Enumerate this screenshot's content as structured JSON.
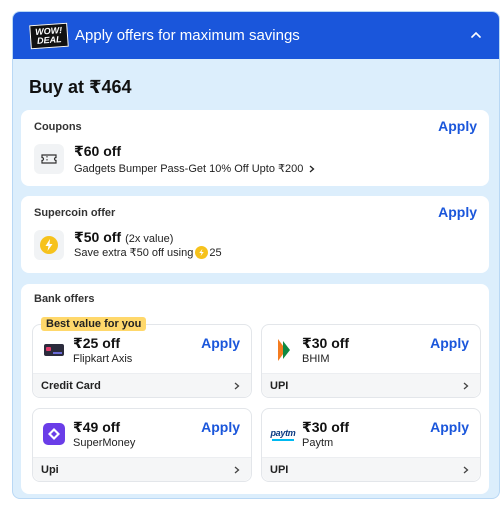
{
  "header": {
    "badge_line1": "WOW!",
    "badge_line2": "DEAL",
    "title": "Apply offers for maximum savings"
  },
  "buy_at": "Buy at ₹464",
  "coupons": {
    "title": "Coupons",
    "apply_label": "Apply",
    "amount": "₹60 off",
    "description": "Gadgets Bumper Pass-Get 10% Off Upto ₹200"
  },
  "supercoin": {
    "title": "Supercoin offer",
    "apply_label": "Apply",
    "amount": "₹50 off",
    "amount_note": "(2x value)",
    "description_prefix": "Save extra ₹50 off using",
    "coin_count": "25"
  },
  "bank": {
    "title": "Bank offers",
    "offers": [
      {
        "badge": "Best value for you",
        "amount": "₹25 off",
        "name": "Flipkart Axis",
        "apply_label": "Apply",
        "footer": "Credit Card"
      },
      {
        "amount": "₹30 off",
        "name": "BHIM",
        "apply_label": "Apply",
        "footer": "UPI"
      },
      {
        "amount": "₹49 off",
        "name": "SuperMoney",
        "apply_label": "Apply",
        "footer": "Upi"
      },
      {
        "amount": "₹30 off",
        "name": "Paytm",
        "apply_label": "Apply",
        "footer": "UPI",
        "logo_text": "paytm"
      }
    ]
  },
  "colors": {
    "header_blue": "#1a56db",
    "panel_bg": "#dceefc",
    "badge_yellow": "#ffd86b",
    "coin_yellow": "#f6c21c"
  },
  "icons": [
    "wow-deal-logo",
    "chevron-up-icon",
    "ticket-icon",
    "chevron-right-icon",
    "lightning-coin-icon",
    "flipkart-axis-card-icon",
    "bhim-logo",
    "supermoney-logo",
    "paytm-logo"
  ]
}
